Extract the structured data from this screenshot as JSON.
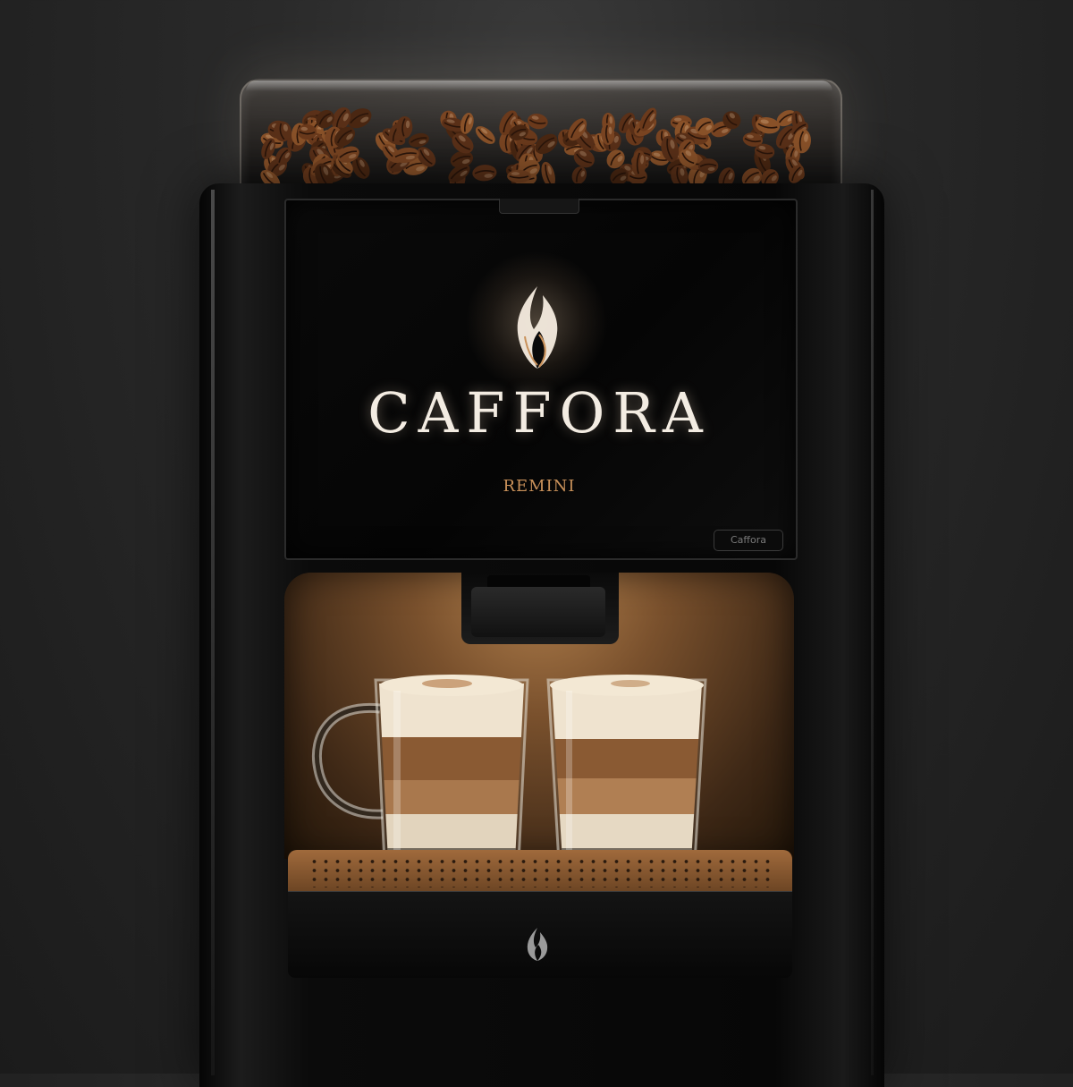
{
  "machine": {
    "brand": "CAFFORA",
    "model": "REMINI",
    "panel_badge": "Caffora",
    "accent_color": "#c9915a",
    "body_color": "#0b0b0b",
    "alcove_color": "#8a5a32"
  },
  "cups": [
    {
      "label": "latte-cup-left",
      "has_handle": true
    },
    {
      "label": "latte-cup-right",
      "has_handle": false
    }
  ],
  "icons": {
    "panel_logo": "flame-leaf-icon",
    "base_logo": "flame-leaf-icon"
  }
}
